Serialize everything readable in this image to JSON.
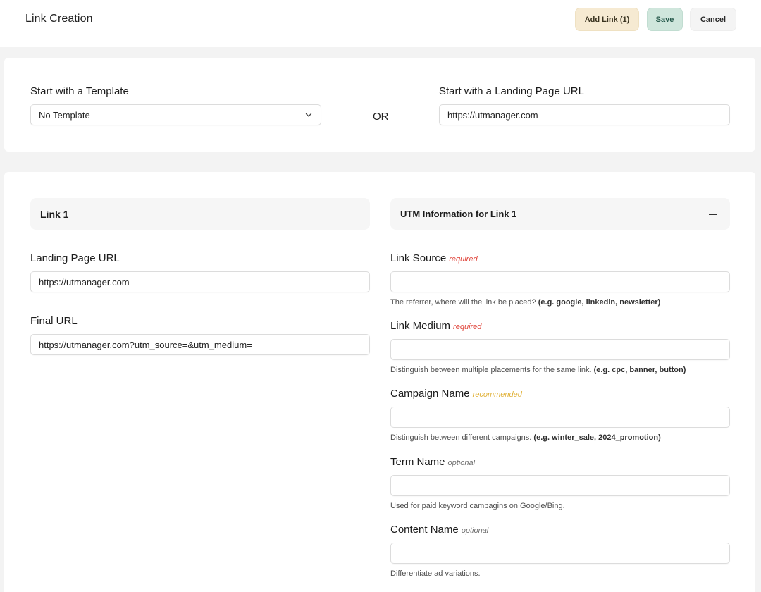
{
  "header": {
    "title": "Link Creation",
    "add_link_label": "Add Link (1)",
    "save_label": "Save",
    "cancel_label": "Cancel"
  },
  "start": {
    "template_label": "Start with a Template",
    "template_value": "No Template",
    "or_label": "OR",
    "landing_label": "Start with a Landing Page URL",
    "landing_value": "https://utmanager.com"
  },
  "link": {
    "section_title": "Link 1",
    "landing_label": "Landing Page URL",
    "landing_value": "https://utmanager.com",
    "final_label": "Final URL",
    "final_value": "https://utmanager.com?utm_source=&utm_medium="
  },
  "utm": {
    "section_title": "UTM Information for Link 1",
    "fields": [
      {
        "label": "Link Source",
        "tag": "required",
        "value": "",
        "help": "The referrer, where will the link be placed?",
        "example": "(e.g. google, linkedin, newsletter)"
      },
      {
        "label": "Link Medium",
        "tag": "required",
        "value": "",
        "help": "Distinguish between multiple placements for the same link.",
        "example": "(e.g. cpc, banner, button)"
      },
      {
        "label": "Campaign Name",
        "tag": "recommended",
        "value": "",
        "help": "Distinguish between different campaigns.",
        "example": "(e.g. winter_sale, 2024_promotion)"
      },
      {
        "label": "Term Name",
        "tag": "optional",
        "value": "",
        "help": "Used for paid keyword campagins on Google/Bing.",
        "example": ""
      },
      {
        "label": "Content Name",
        "tag": "optional",
        "value": "",
        "help": "Differentiate ad variations.",
        "example": ""
      }
    ]
  },
  "colors": {
    "required": "#e0443a",
    "recommended": "#e1b23a",
    "optional": "#6e6e6e",
    "add_button_bg": "#f6ead2",
    "save_button_bg": "#cfe6dc"
  },
  "icons": {
    "select_chevron": "chevron-down-icon",
    "collapse": "minus-icon"
  }
}
